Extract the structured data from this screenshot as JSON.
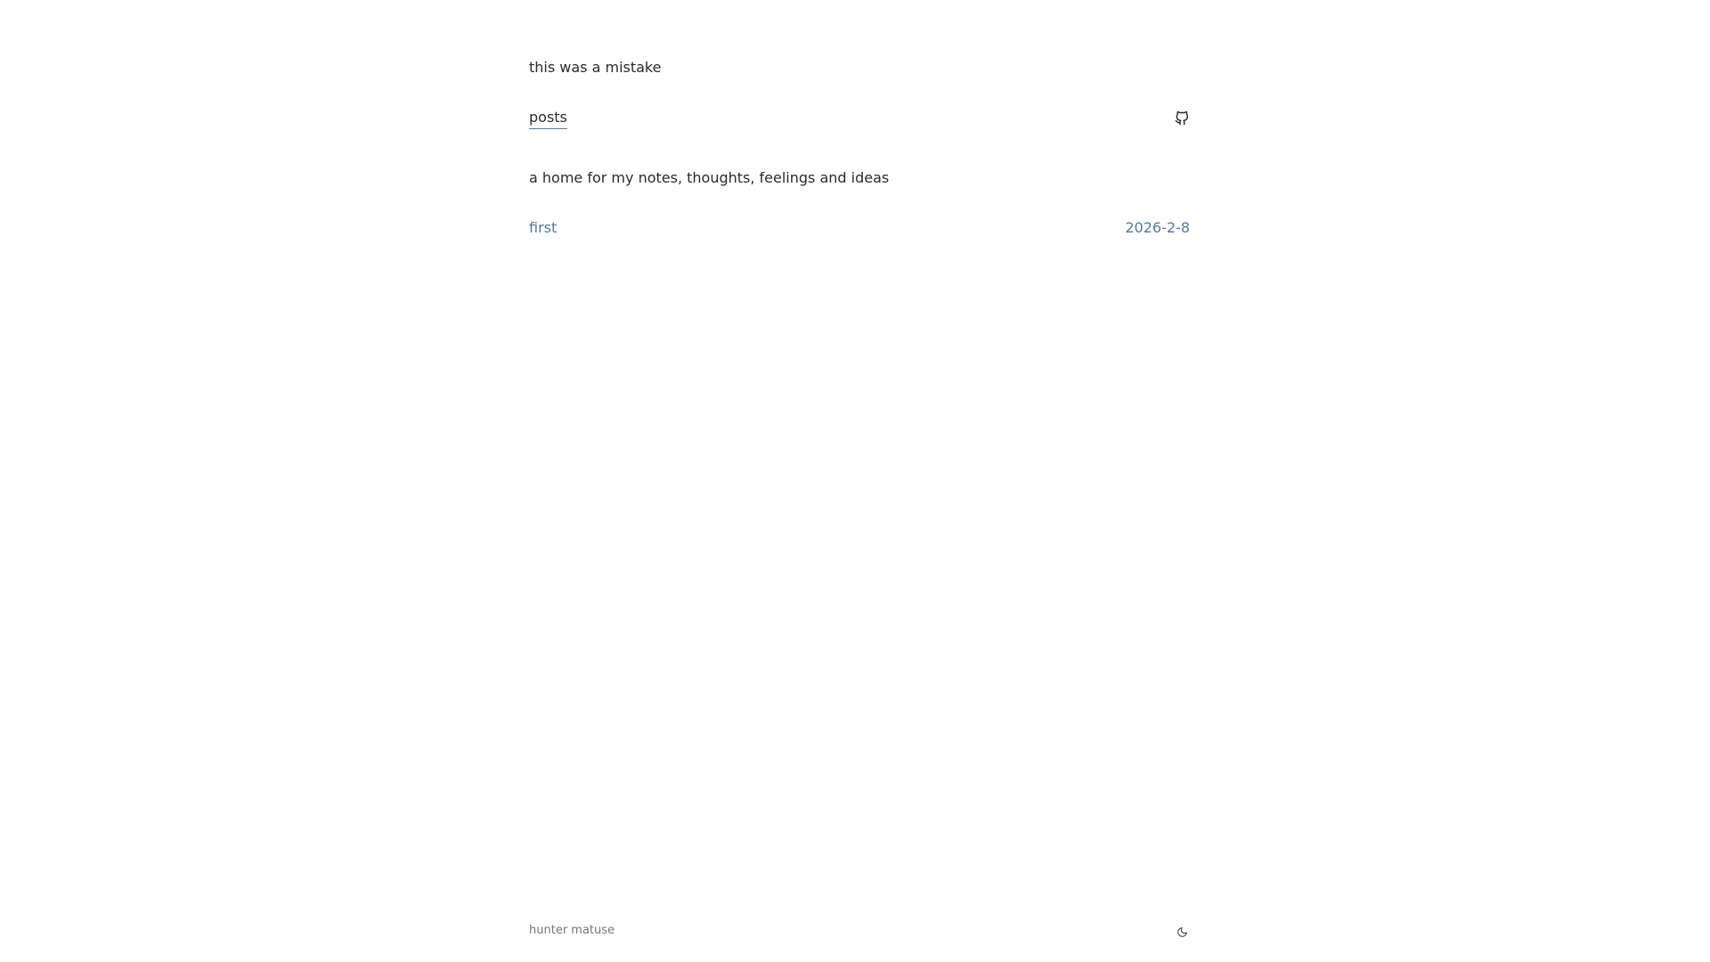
{
  "header": {
    "site_title": "this was a mistake",
    "nav": {
      "posts_label": "posts",
      "github_icon": "github-icon"
    }
  },
  "main": {
    "tagline": "a home for my notes, thoughts, feelings and ideas",
    "posts": [
      {
        "title": "first",
        "date": "2026-2-8"
      }
    ]
  },
  "footer": {
    "author": "hunter matuse",
    "theme_icon": "moon-icon"
  },
  "colors": {
    "text": "#2b2b2b",
    "link": "#5a74ac",
    "muted": "#777777",
    "background": "#ffffff"
  }
}
